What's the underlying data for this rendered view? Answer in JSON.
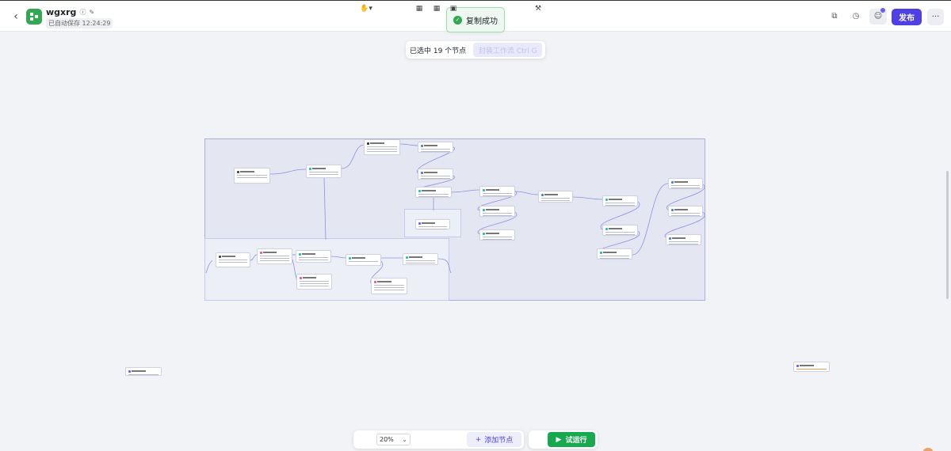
{
  "header": {
    "app_name": "wgxrg",
    "autosave_text": "已自动保存 12:24:29",
    "publish_label": "发布",
    "more_label": "···",
    "back_icon": "chevron-left-icon"
  },
  "toast": {
    "message": "复制成功"
  },
  "selection": {
    "text": "已选中 19 个节点",
    "wrap_label": "封装工作流 Ctrl G"
  },
  "toolbar": {
    "zoom_value": "20%",
    "add_node_label": "添加节点",
    "run_label": "试运行"
  },
  "colors": {
    "accent": "#4e40e5",
    "run": "#18a84e",
    "toast_bg": "#edf9f0"
  }
}
